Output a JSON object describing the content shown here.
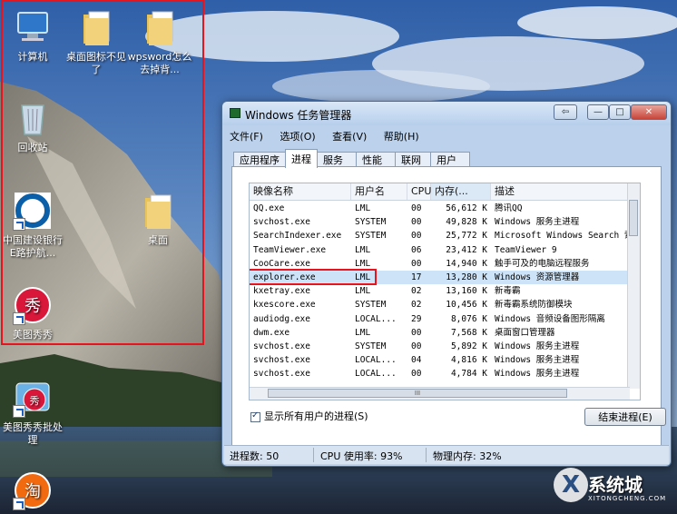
{
  "desktop": {
    "icons": [
      {
        "label": "计算机"
      },
      {
        "label": "桌面图标不见了"
      },
      {
        "label": "wpsword怎么去掉背..."
      },
      {
        "label": "回收站"
      },
      {
        "label": "中国建设银行E路护航..."
      },
      {
        "label": "桌面"
      },
      {
        "label": "美图秀秀"
      },
      {
        "label": "美图秀秀批处理"
      },
      {
        "label": "淘"
      }
    ]
  },
  "window": {
    "title": "Windows 任务管理器",
    "buttons": {
      "back": "⇦",
      "minimize": "—",
      "maximize": "□",
      "close": "✕"
    },
    "menu": [
      "文件(F)",
      "选项(O)",
      "查看(V)",
      "帮助(H)"
    ],
    "tabs": [
      "应用程序",
      "进程",
      "服务",
      "性能",
      "联网",
      "用户"
    ],
    "active_tab": "进程",
    "columns": [
      "映像名称",
      "用户名",
      "CPU",
      "内存(...",
      "描述"
    ],
    "processes": [
      {
        "name": "QQ.exe",
        "user": "LML",
        "cpu": "00",
        "mem": "56,612 K",
        "desc": "腾讯QQ"
      },
      {
        "name": "svchost.exe",
        "user": "SYSTEM",
        "cpu": "00",
        "mem": "49,828 K",
        "desc": "Windows 服务主进程"
      },
      {
        "name": "SearchIndexer.exe",
        "user": "SYSTEM",
        "cpu": "00",
        "mem": "25,772 K",
        "desc": "Microsoft Windows Search 索"
      },
      {
        "name": "TeamViewer.exe",
        "user": "LML",
        "cpu": "06",
        "mem": "23,412 K",
        "desc": "TeamViewer 9"
      },
      {
        "name": "CooCare.exe",
        "user": "LML",
        "cpu": "00",
        "mem": "14,940 K",
        "desc": "触手可及的电脑远程服务"
      },
      {
        "name": "explorer.exe",
        "user": "LML",
        "cpu": "17",
        "mem": "13,280 K",
        "desc": "Windows 资源管理器"
      },
      {
        "name": "kxetray.exe",
        "user": "LML",
        "cpu": "02",
        "mem": "13,160 K",
        "desc": "新毒霸"
      },
      {
        "name": "kxescore.exe",
        "user": "SYSTEM",
        "cpu": "02",
        "mem": "10,456 K",
        "desc": "新毒霸系统防御模块"
      },
      {
        "name": "audiodg.exe",
        "user": "LOCAL...",
        "cpu": "29",
        "mem": "8,076 K",
        "desc": "Windows 音频设备图形隔离"
      },
      {
        "name": "dwm.exe",
        "user": "LML",
        "cpu": "00",
        "mem": "7,568 K",
        "desc": "桌面窗口管理器"
      },
      {
        "name": "svchost.exe",
        "user": "SYSTEM",
        "cpu": "00",
        "mem": "5,892 K",
        "desc": "Windows 服务主进程"
      },
      {
        "name": "svchost.exe",
        "user": "LOCAL...",
        "cpu": "04",
        "mem": "4,816 K",
        "desc": "Windows 服务主进程"
      },
      {
        "name": "svchost.exe",
        "user": "LOCAL...",
        "cpu": "00",
        "mem": "4,784 K",
        "desc": "Windows 服务主进程"
      }
    ],
    "selected_index": 5,
    "hscroll_grip": "III",
    "show_all_users": "显示所有用户的进程(S)",
    "end_process": "结束进程(E)",
    "status": {
      "processes": "进程数: 50",
      "cpu": "CPU 使用率: 93%",
      "memory": "物理内存: 32%"
    }
  },
  "watermark": {
    "mark": "X",
    "title": "系统城",
    "sub": "XITONGCHENG.COM"
  }
}
